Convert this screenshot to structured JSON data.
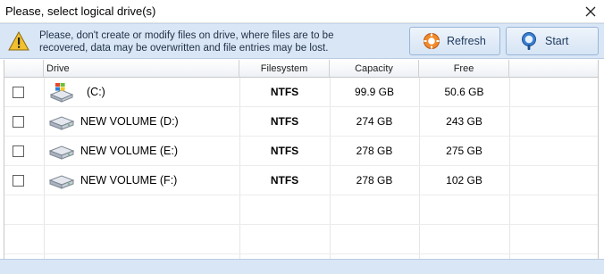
{
  "window": {
    "title": "Please, select logical drive(s)"
  },
  "infobar": {
    "warning_line1": "Please, don't create or modify files on drive, where files are to be",
    "warning_line2": "recovered, data may be overwritten and file entries may be lost.",
    "refresh_label": "Refresh",
    "start_label": "Start"
  },
  "table": {
    "columns": [
      "Drive",
      "Filesystem",
      "Capacity",
      "Free"
    ],
    "rows": [
      {
        "checked": false,
        "icon": "windows-drive-icon",
        "name": "(C:)",
        "filesystem": "NTFS",
        "capacity": "99.9 GB",
        "free": "50.6 GB"
      },
      {
        "checked": false,
        "icon": "hard-drive-icon",
        "name": "NEW VOLUME (D:)",
        "filesystem": "NTFS",
        "capacity": "274 GB",
        "free": "243 GB"
      },
      {
        "checked": false,
        "icon": "hard-drive-icon",
        "name": "NEW VOLUME (E:)",
        "filesystem": "NTFS",
        "capacity": "278 GB",
        "free": "275 GB"
      },
      {
        "checked": false,
        "icon": "hard-drive-icon",
        "name": "NEW VOLUME (F:)",
        "filesystem": "NTFS",
        "capacity": "278 GB",
        "free": "102 GB"
      }
    ]
  },
  "colors": {
    "accent_bar": "#d9e6f5",
    "button_text": "#1e3a5f",
    "warning_icon": "#f2c12e"
  }
}
